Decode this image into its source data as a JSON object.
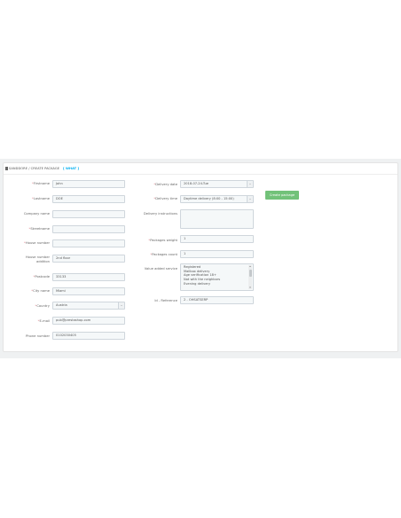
{
  "panel": {
    "title": "SANDDORE / CREATE PACKAGE",
    "badge": "[ WHAT ]"
  },
  "left": {
    "firstname": {
      "label": "Firstname",
      "required": "*",
      "value": "John"
    },
    "lastname": {
      "label": "Lastname",
      "required": "*",
      "value": "DOE"
    },
    "company": {
      "label": "Company name",
      "value": ""
    },
    "street": {
      "label": "Streetname",
      "required": "*",
      "value": ""
    },
    "house_number": {
      "label": "House number",
      "required": "*",
      "value": ""
    },
    "house_addition": {
      "label_line1": "House number",
      "label_line2": "addition",
      "value": "2nd floor"
    },
    "postcode": {
      "label": "Postcode",
      "required": "*",
      "value": "33133"
    },
    "city": {
      "label": "City name",
      "required": "*",
      "value": "Miami"
    },
    "country": {
      "label": "Country",
      "required": "*",
      "value": "Austria"
    },
    "email": {
      "label": "E-mail",
      "required": "*",
      "value": "pub@prestashop.com"
    },
    "phone": {
      "label": "Phone number",
      "value": "0102030405"
    }
  },
  "right": {
    "delivery_date": {
      "label": "Delivery date",
      "required": "*",
      "value": "2018-07-24-Tue"
    },
    "delivery_time": {
      "label": "Delivery time",
      "required": "*",
      "value": "Daytime delivery (8:00 - 15:00)"
    },
    "delivery_instructions": {
      "label": "Delivery instructions"
    },
    "packages_weight": {
      "label": "Packages weight",
      "required": "*",
      "value": "1"
    },
    "packages_count": {
      "label": "Packages count",
      "required": "*",
      "value": "1"
    },
    "value_added": {
      "label": "Value added service",
      "options": [
        "Registered",
        "Mailbox delivery",
        "Age verification 18+",
        "Not with the neighbors",
        "Evening delivery"
      ]
    },
    "reference": {
      "label": "Id - Reference",
      "value": "2 - OHSATSERP"
    }
  },
  "buttons": {
    "create": "Create package"
  }
}
